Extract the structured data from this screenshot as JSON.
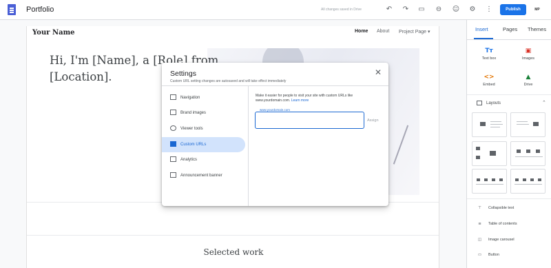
{
  "topbar": {
    "title": "Portfolio",
    "save_status": "All changes saved in Drive",
    "publish_label": "Publish",
    "user_initials": "MP"
  },
  "site": {
    "name": "Your Name",
    "nav": {
      "home": "Home",
      "about": "About",
      "project": "Project Page"
    },
    "hero_text": "Hi, I'm [Name], a [Role] from [Location].",
    "section_heading": "Selected work"
  },
  "panel": {
    "tabs": [
      "Insert",
      "Pages",
      "Themes"
    ],
    "insert_items": [
      "Text box",
      "Images",
      "Embed",
      "Drive"
    ],
    "layouts_label": "Layouts",
    "components": [
      "Collapsible text",
      "Table of contents",
      "Image carousel",
      "Button"
    ]
  },
  "dialog": {
    "title": "Settings",
    "subtitle": "Custom URL setting changes are autosaved and will take effect immediately",
    "nav": [
      "Navigation",
      "Brand images",
      "Viewer tools",
      "Custom URLs",
      "Analytics",
      "Announcement banner"
    ],
    "active_nav": "Custom URLs",
    "info_text": "Make it easier for people to visit your site with custom URLs like www.yourdomain.com.",
    "learn_more": "Learn more",
    "field_label": "www.yourdomain.com",
    "field_value": "",
    "assign_label": "Assign"
  },
  "colors": {
    "accent": "#1967d2",
    "publish": "#1a73e8",
    "logo": "#4a5fd6"
  }
}
